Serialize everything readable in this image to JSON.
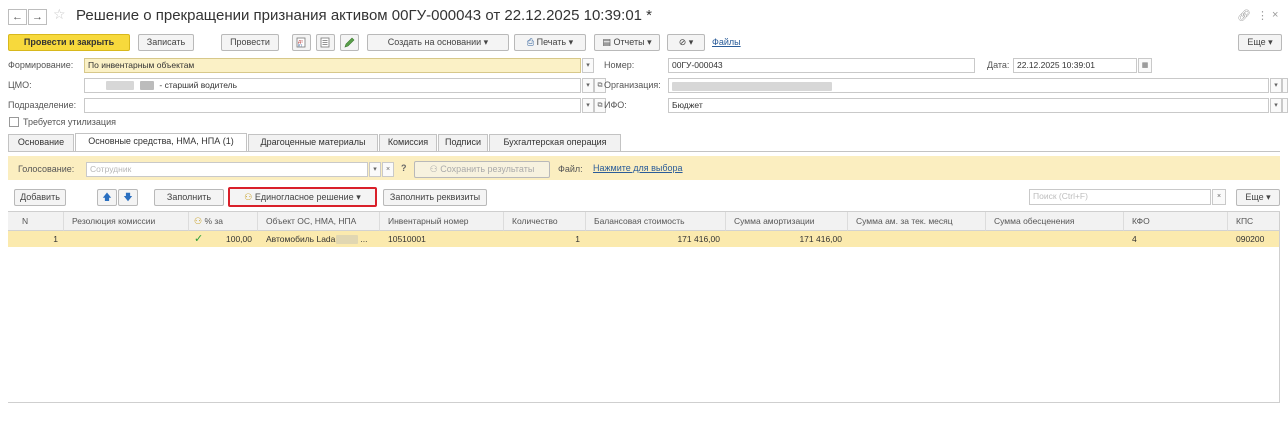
{
  "window": {
    "title": "Решение о прекращении признания активом 00ГУ-000043 от 22.12.2025 10:39:01 *"
  },
  "toolbar": {
    "post_close": "Провести и закрыть",
    "save": "Записать",
    "post": "Провести",
    "create_based": "Создать на основании",
    "print": "Печать",
    "reports": "Отчеты",
    "files": "Файлы",
    "more": "Еще"
  },
  "form": {
    "formation_label": "Формирование:",
    "formation_value": "По инвентарным объектам",
    "cmo_label": "ЦМО:",
    "cmo_value": "- старший водитель",
    "division_label": "Подразделение:",
    "division_value": "",
    "utilization_label": "Требуется утилизация",
    "number_label": "Номер:",
    "number_value": "00ГУ-000043",
    "date_label": "Дата:",
    "date_value": "22.12.2025 10:39:01",
    "org_label": "Организация:",
    "ifo_label": "ИФО:",
    "ifo_value": "Бюджет"
  },
  "tabs": [
    {
      "label": "Основание"
    },
    {
      "label": "Основные средства, НМА, НПА (1)"
    },
    {
      "label": "Драгоценные материалы"
    },
    {
      "label": "Комиссия"
    },
    {
      "label": "Подписи"
    },
    {
      "label": "Бухгалтерская операция"
    }
  ],
  "voting": {
    "label": "Голосование:",
    "employee_placeholder": "Сотрудник",
    "help": "?",
    "save_results": "Сохранить результаты",
    "file_label": "Файл:",
    "file_link": "Нажмите для выбора"
  },
  "table_toolbar": {
    "add": "Добавить",
    "fill": "Заполнить",
    "unanimous": "Единогласное решение",
    "fill_details": "Заполнить реквизиты",
    "search_placeholder": "Поиск (Ctrl+F)",
    "clear": "×",
    "more": "Еще"
  },
  "table": {
    "columns": [
      "N",
      "Резолюция комиссии",
      "% за",
      "Объект ОС, НМА, НПА",
      "Инвентарный номер",
      "Количество",
      "Балансовая стоимость",
      "Сумма амортизации",
      "Сумма ам. за тек. месяц",
      "Сумма обесценения",
      "КФО",
      "КПС"
    ],
    "rows": [
      {
        "n": "1",
        "resolution": "",
        "percent_for": "100,00",
        "object": "Автомобиль Lada",
        "inventory_number": "10510001",
        "quantity": "1",
        "book_value": "171 416,00",
        "depreciation": "171 416,00",
        "depreciation_month": "",
        "impairment": "",
        "kfo": "4",
        "kps": "090200"
      }
    ]
  },
  "colors": {
    "primary_button": "#f7d93c",
    "highlight_row": "#fbeaae",
    "voting_panel": "#fbeec0",
    "highlight_border": "#d9202a",
    "check": "#2e9e3a",
    "link": "#2a5c99"
  }
}
